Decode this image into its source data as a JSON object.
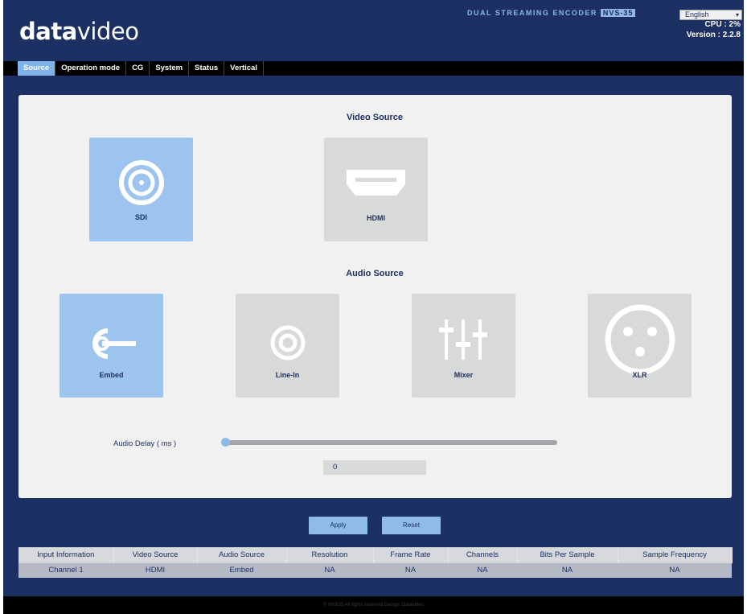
{
  "header": {
    "logo_bold": "data",
    "logo_light": "video",
    "product_name": "DUAL STREAMING ENCODER",
    "model": "NVS-35",
    "language_selected": "English",
    "cpu": "CPU : 2%",
    "version": "Version : 2.2.8"
  },
  "nav": {
    "tabs": [
      {
        "label": "Source",
        "active": true
      },
      {
        "label": "Operation mode"
      },
      {
        "label": "CG"
      },
      {
        "label": "System"
      },
      {
        "label": "Status"
      },
      {
        "label": "Vertical"
      }
    ]
  },
  "video_source": {
    "title": "Video Source",
    "options": [
      {
        "label": "SDI",
        "icon": "sdi-icon",
        "selected": true
      },
      {
        "label": "HDMI",
        "icon": "hdmi-icon",
        "selected": false
      }
    ]
  },
  "audio_source": {
    "title": "Audio Source",
    "options": [
      {
        "label": "Embed",
        "icon": "embed-icon",
        "selected": true
      },
      {
        "label": "Line-In",
        "icon": "line-in-icon",
        "selected": false
      },
      {
        "label": "Mixer",
        "icon": "mixer-icon",
        "selected": false
      },
      {
        "label": "XLR",
        "icon": "xlr-icon",
        "selected": false
      }
    ]
  },
  "audio_delay": {
    "label": "Audio Delay ( ms )",
    "value": "0"
  },
  "actions": {
    "apply": "Apply",
    "reset": "Reset"
  },
  "info_table": {
    "headers": [
      "Input Information",
      "Video Source",
      "Audio Source",
      "Resolution",
      "Frame Rate",
      "Channels",
      "Bits Per Sample",
      "Sample Frequency"
    ],
    "row": [
      "Channel 1",
      "HDMI",
      "Embed",
      "NA",
      "NA",
      "NA",
      "NA",
      "NA"
    ]
  },
  "footer": {
    "text": "© NVS35 All rights reserved Design: Datavideo"
  },
  "colors": {
    "background": "#1c3064",
    "accent": "#7fb2e8",
    "tile_selected": "#9cc4ef",
    "tile_default": "#d8d9d9"
  }
}
